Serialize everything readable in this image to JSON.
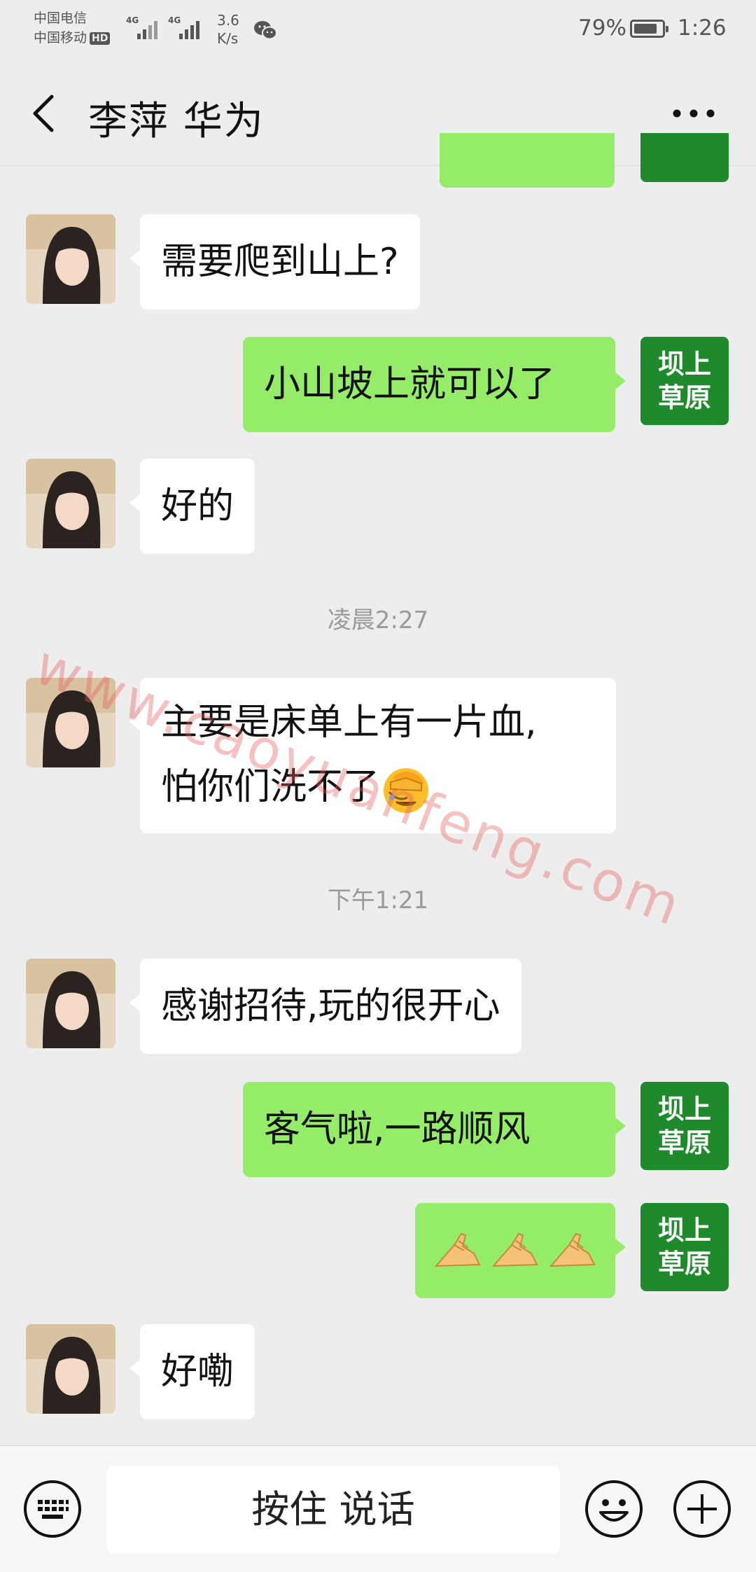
{
  "status_bar": {
    "carrier1": "中国电信",
    "carrier2": "中国移动",
    "hd_badge": "HD",
    "signal1_tag": "4G",
    "signal2_tag": "4G",
    "net_speed_value": "3.6",
    "net_speed_unit": "K/s",
    "battery": "79%",
    "time": "1:26"
  },
  "header": {
    "title": "李萍 华为"
  },
  "self_avatar": {
    "line1": "坝上",
    "line2": "草原"
  },
  "messages": [
    {
      "sender": "other",
      "text": "需要爬到山上?"
    },
    {
      "sender": "self",
      "text": "小山坡上就可以了"
    },
    {
      "sender": "other",
      "text": "好的"
    },
    {
      "type": "time",
      "text": "凌晨2:27"
    },
    {
      "sender": "other",
      "line1": "主要是床单上有一片血,",
      "line2": "怕你们洗不了",
      "emoji": "facepalm-emoji"
    },
    {
      "type": "time",
      "text": "下午1:21"
    },
    {
      "sender": "other",
      "text": "感谢招待,玩的很开心"
    },
    {
      "sender": "self",
      "text": "客气啦,一路顺风"
    },
    {
      "sender": "self",
      "emoji": "pinched-fingers-emoji",
      "count": 3
    },
    {
      "sender": "other",
      "text": "好嘞"
    }
  ],
  "watermark": "www.caoyuanfeng.com",
  "input_bar": {
    "talk_label": "按住 说话"
  },
  "colors": {
    "background": "#ededed",
    "self_bubble": "#95ec69",
    "other_bubble": "#ffffff",
    "self_avatar_bg": "#1f8a2c",
    "watermark": "#e85c5c"
  }
}
